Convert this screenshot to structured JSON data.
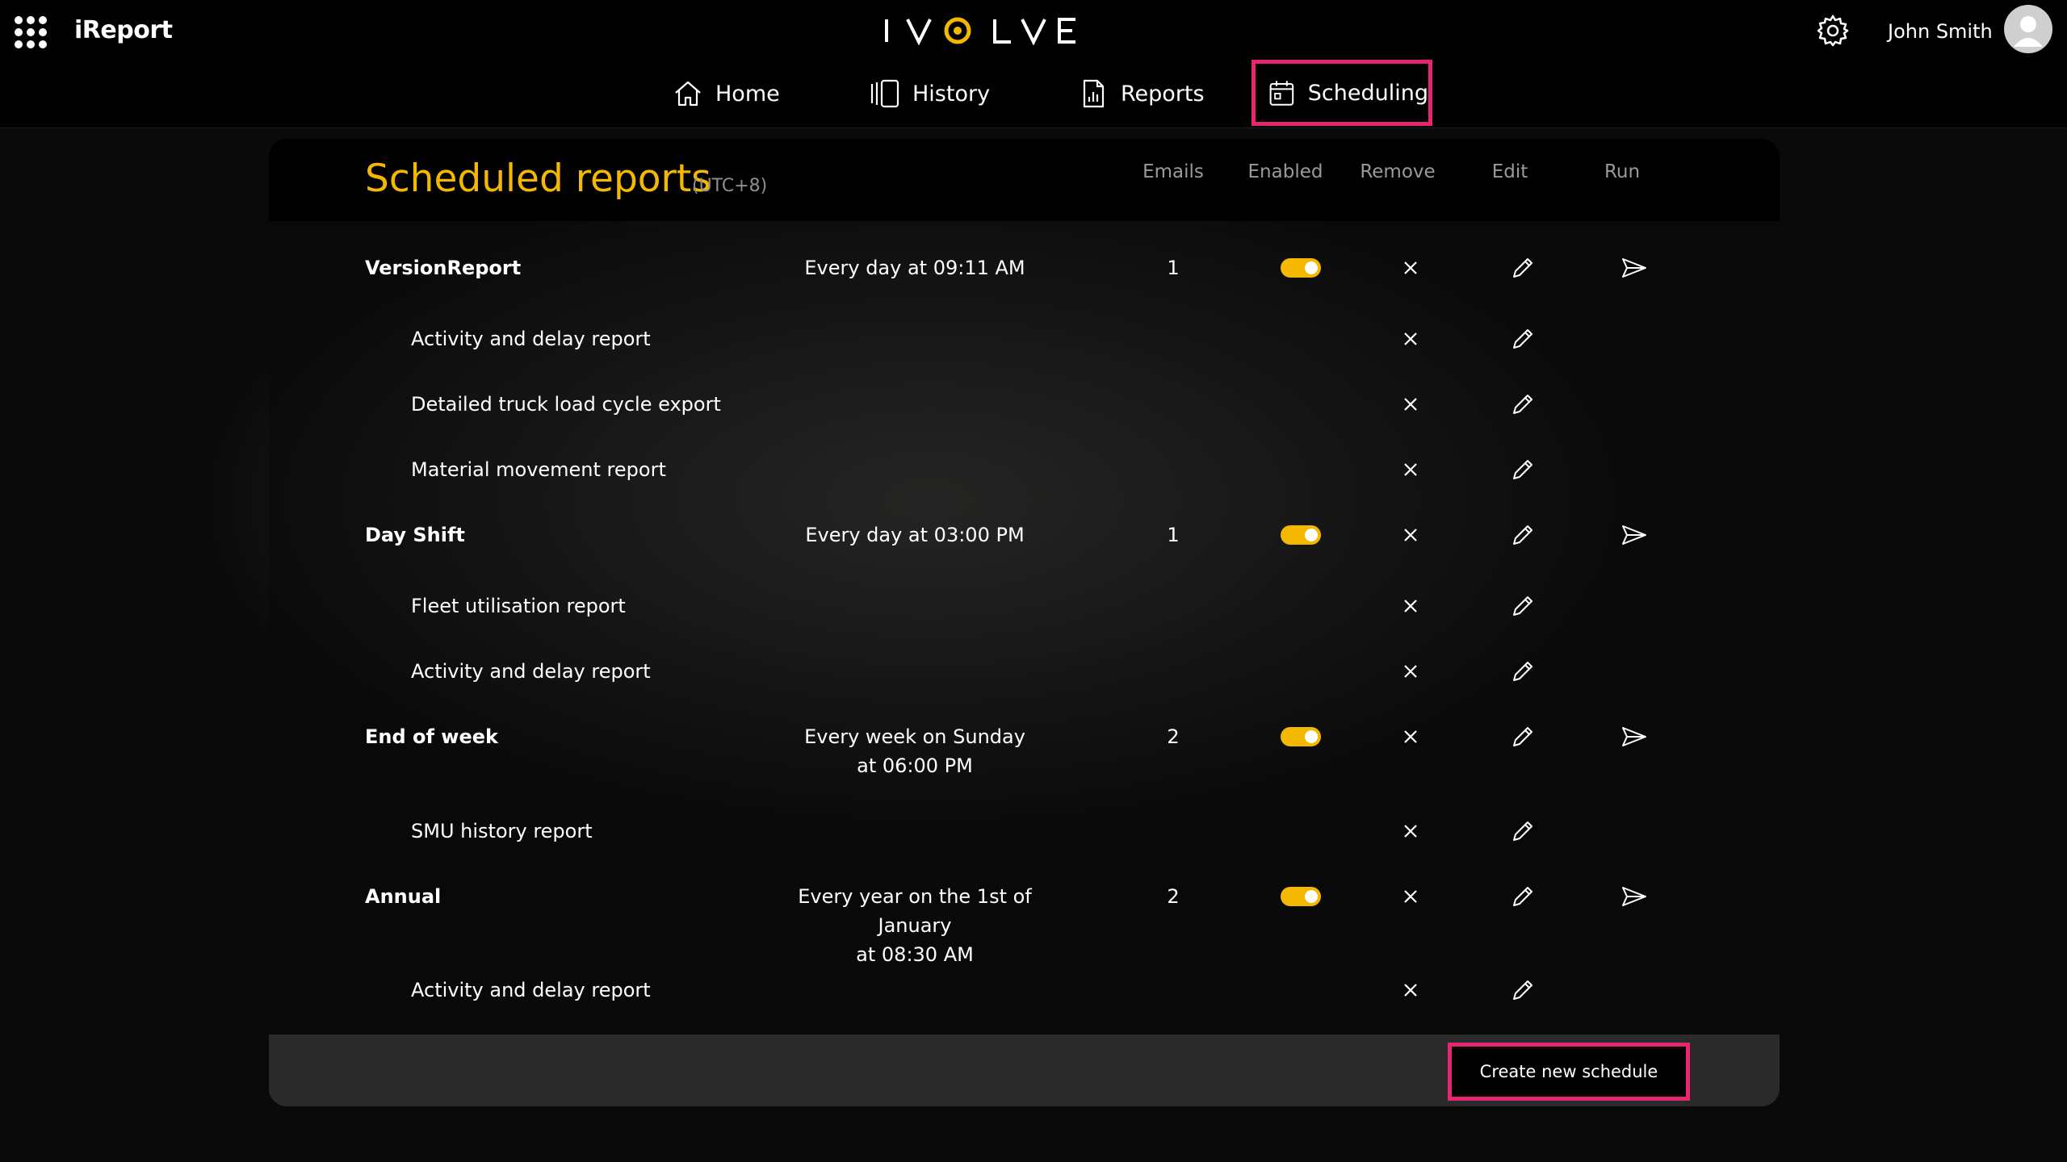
{
  "app": {
    "name": "iReport",
    "logo_text": "IVOLVE"
  },
  "user": {
    "name": "John Smith"
  },
  "nav": [
    {
      "label": "Home",
      "icon": "home-icon"
    },
    {
      "label": "History",
      "icon": "history-icon"
    },
    {
      "label": "Reports",
      "icon": "report-icon"
    },
    {
      "label": "Scheduling",
      "icon": "calendar-icon",
      "active": true
    }
  ],
  "page": {
    "title": "Scheduled reports",
    "timezone": "(UTC+8)"
  },
  "columns": {
    "emails": "Emails",
    "enabled": "Enabled",
    "remove": "Remove",
    "edit": "Edit",
    "run": "Run"
  },
  "schedules": [
    {
      "name": "VersionReport",
      "frequency_line1": "Every day at 09:11 AM",
      "frequency_line2": "",
      "emails": "1",
      "enabled": true,
      "reports": [
        "Activity and delay report",
        "Detailed truck load cycle export",
        "Material movement report"
      ]
    },
    {
      "name": "Day Shift",
      "frequency_line1": "Every day at 03:00 PM",
      "frequency_line2": "",
      "emails": "1",
      "enabled": true,
      "reports": [
        "Fleet utilisation report",
        "Activity and delay report"
      ]
    },
    {
      "name": "End of week",
      "frequency_line1": "Every week on Sunday",
      "frequency_line2": "at 06:00 PM",
      "emails": "2",
      "enabled": true,
      "reports": [
        "SMU history report"
      ]
    },
    {
      "name": "Annual",
      "frequency_line1": "Every year on the 1st of January",
      "frequency_line2": "at 08:30 AM",
      "emails": "2",
      "enabled": true,
      "reports": [
        "Activity and delay report"
      ]
    }
  ],
  "actions": {
    "create_label": "Create new schedule"
  },
  "colors": {
    "accent": "#f5b800",
    "highlight": "#e8266f"
  }
}
